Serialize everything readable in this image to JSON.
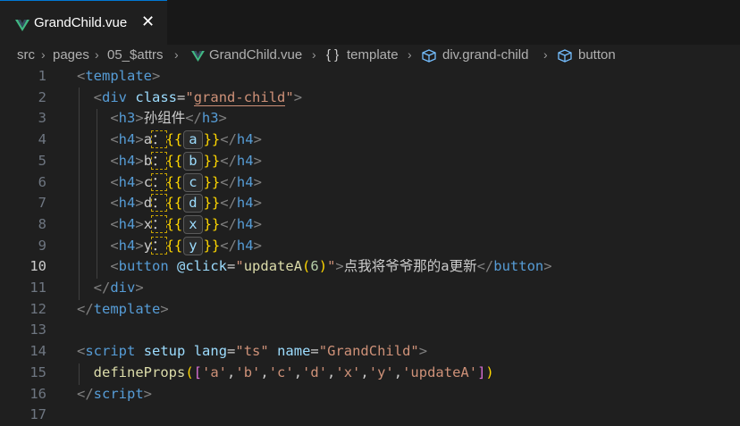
{
  "tab": {
    "label": "GrandChild.vue",
    "close": "✕"
  },
  "breadcrumb": [
    "src",
    "pages",
    "05_$attrs",
    "GrandChild.vue",
    "template",
    "div.grand-child",
    "button"
  ],
  "code": {
    "line_numbers": [
      "1",
      "2",
      "3",
      "4",
      "5",
      "6",
      "7",
      "8",
      "9",
      "10",
      "11",
      "12",
      "13",
      "14",
      "15",
      "16",
      "17"
    ],
    "active_line": "10",
    "h3_text": "孙组件",
    "h4_labels": [
      "a",
      "b",
      "c",
      "d",
      "x",
      "y"
    ],
    "button_label": "点我将爷爷那的a更新",
    "button_arg": "6",
    "click_handler": "updateA",
    "div_class": "grand-child",
    "script_lang": "ts",
    "script_name": "GrandChild",
    "props": [
      "'a'",
      "'b'",
      "'c'",
      "'d'",
      "'x'",
      "'y'",
      "'updateA'"
    ]
  },
  "colors": {
    "accent": "#0078d4",
    "tag": "#569cd6",
    "string": "#ce9178",
    "attr": "#9cdcfe",
    "bracket": "#ffd700"
  }
}
